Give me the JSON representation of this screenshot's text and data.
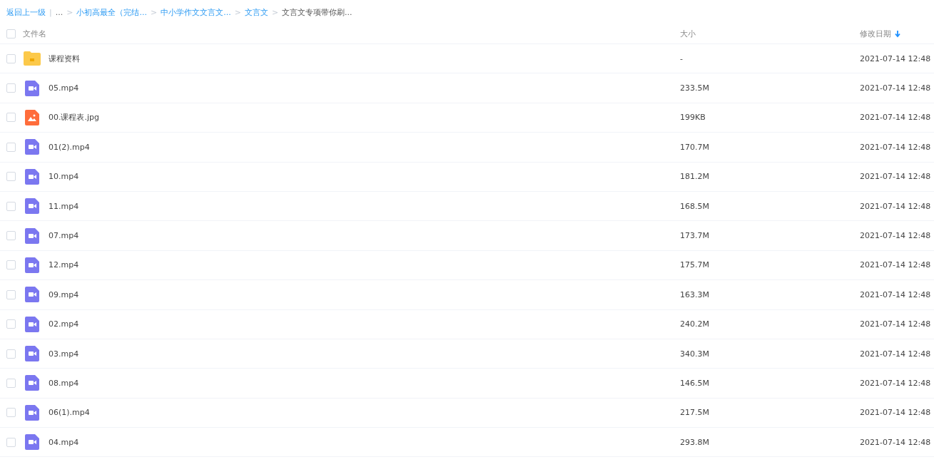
{
  "breadcrumb": [
    {
      "text": "返回上一级",
      "kind": "link"
    },
    {
      "text": "|",
      "kind": "sep"
    },
    {
      "text": "...",
      "kind": "plain"
    },
    {
      "text": ">",
      "kind": "sep"
    },
    {
      "text": "小初高最全（完结...",
      "kind": "link"
    },
    {
      "text": ">",
      "kind": "sep"
    },
    {
      "text": "中小学作文文言文...",
      "kind": "link"
    },
    {
      "text": ">",
      "kind": "sep"
    },
    {
      "text": "文言文",
      "kind": "link"
    },
    {
      "text": ">",
      "kind": "sep"
    },
    {
      "text": "文言文专项带你刷...",
      "kind": "current"
    }
  ],
  "table": {
    "select_all": {
      "checked": false
    },
    "columns": [
      "文件名",
      "大小",
      "修改日期"
    ],
    "rows": [
      {
        "kind": "folder",
        "name": "课程资料",
        "size": "-",
        "date": "2021-07-14 12:48",
        "checked": false
      },
      {
        "kind": "video",
        "name": "05.mp4",
        "size": "233.5M",
        "date": "2021-07-14 12:48",
        "checked": false
      },
      {
        "kind": "image",
        "name": "00.课程表.jpg",
        "size": "199KB",
        "date": "2021-07-14 12:48",
        "checked": false
      },
      {
        "kind": "video",
        "name": "01(2).mp4",
        "size": "170.7M",
        "date": "2021-07-14 12:48",
        "checked": false
      },
      {
        "kind": "video",
        "name": "10.mp4",
        "size": "181.2M",
        "date": "2021-07-14 12:48",
        "checked": false
      },
      {
        "kind": "video",
        "name": "11.mp4",
        "size": "168.5M",
        "date": "2021-07-14 12:48",
        "checked": false
      },
      {
        "kind": "video",
        "name": "07.mp4",
        "size": "173.7M",
        "date": "2021-07-14 12:48",
        "checked": false
      },
      {
        "kind": "video",
        "name": "12.mp4",
        "size": "175.7M",
        "date": "2021-07-14 12:48",
        "checked": false
      },
      {
        "kind": "video",
        "name": "09.mp4",
        "size": "163.3M",
        "date": "2021-07-14 12:48",
        "checked": false
      },
      {
        "kind": "video",
        "name": "02.mp4",
        "size": "240.2M",
        "date": "2021-07-14 12:48",
        "checked": false
      },
      {
        "kind": "video",
        "name": "03.mp4",
        "size": "340.3M",
        "date": "2021-07-14 12:48",
        "checked": false
      },
      {
        "kind": "video",
        "name": "08.mp4",
        "size": "146.5M",
        "date": "2021-07-14 12:48",
        "checked": false
      },
      {
        "kind": "video",
        "name": "06(1).mp4",
        "size": "217.5M",
        "date": "2021-07-14 12:48",
        "checked": false
      },
      {
        "kind": "video",
        "name": "04.mp4",
        "size": "293.8M",
        "date": "2021-07-14 12:48",
        "checked": false
      }
    ]
  }
}
